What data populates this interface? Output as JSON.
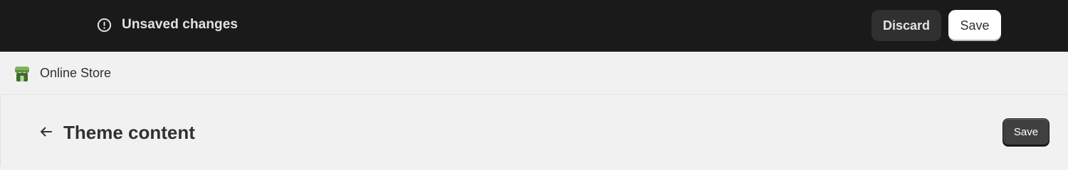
{
  "topbar": {
    "status_text": "Unsaved changes",
    "status_icon": "alert-circle-icon",
    "discard_label": "Discard",
    "save_label": "Save"
  },
  "subbar": {
    "app_icon": "storefront-icon",
    "app_name": "Online Store"
  },
  "page": {
    "back_icon": "arrow-left-icon",
    "title": "Theme content",
    "save_label": "Save"
  },
  "colors": {
    "topbar_bg": "#1a1a1a",
    "page_bg": "#f1f1f1",
    "store_icon_green": "#5e8e3e",
    "primary_button": "#404040"
  }
}
